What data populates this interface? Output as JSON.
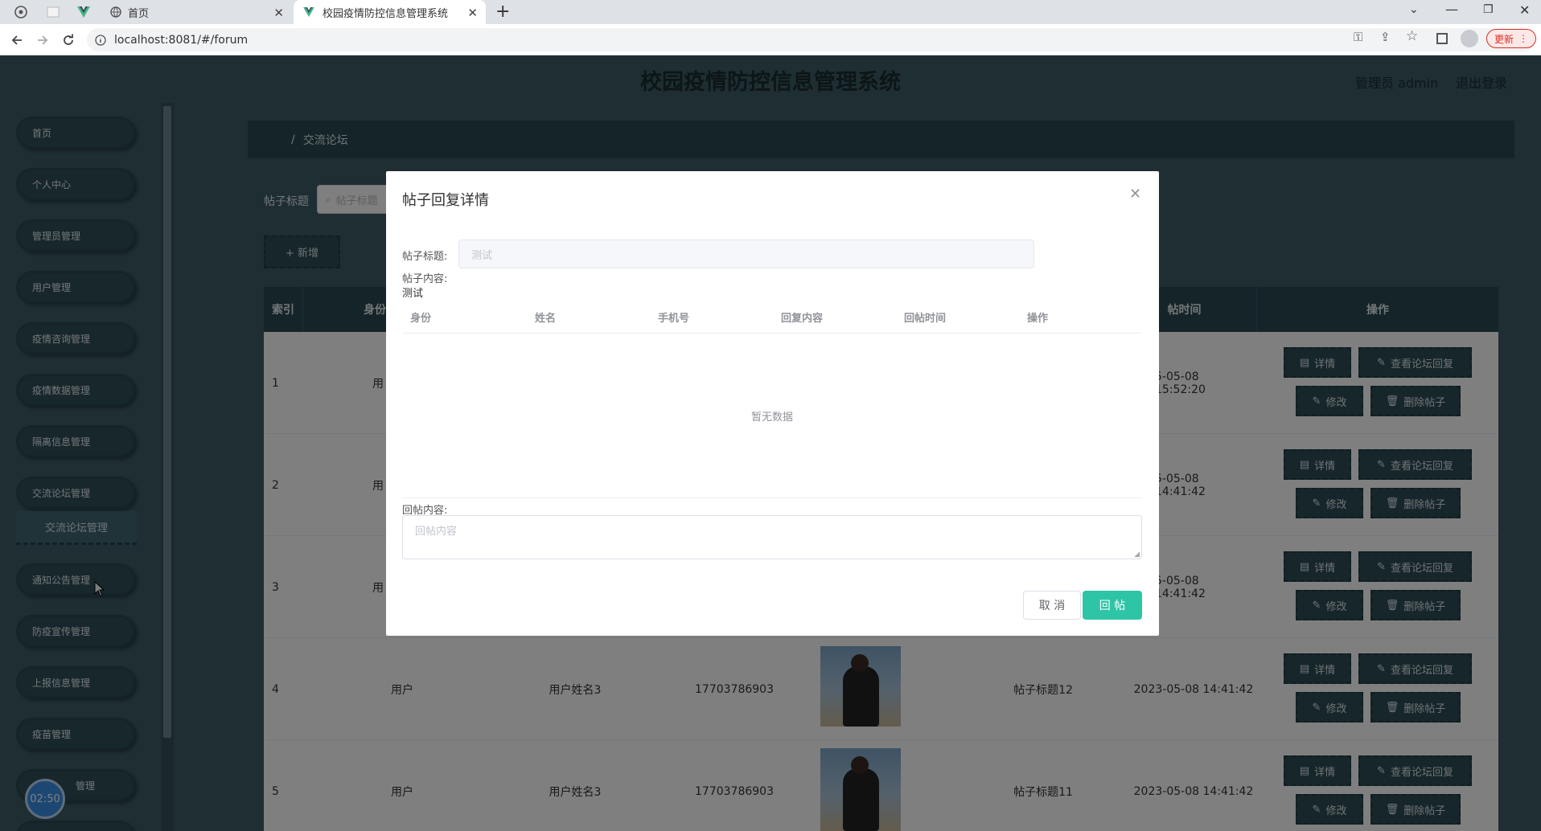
{
  "browser": {
    "tabs": [
      {
        "title": "首页"
      },
      {
        "title": "校园疫情防控信息管理系统"
      }
    ],
    "url": "localhost:8081/#/forum",
    "update_label": "更新"
  },
  "header": {
    "title": "校园疫情防控信息管理系统",
    "user": "管理员 admin",
    "logout": "退出登录"
  },
  "sidebar": {
    "items": [
      {
        "label": "首页"
      },
      {
        "label": "个人中心"
      },
      {
        "label": "管理员管理"
      },
      {
        "label": "用户管理"
      },
      {
        "label": "疫情咨询管理"
      },
      {
        "label": "疫情数据管理"
      },
      {
        "label": "隔离信息管理"
      },
      {
        "label": "交流论坛管理"
      },
      {
        "label": "通知公告管理"
      },
      {
        "label": "防疫宣传管理"
      },
      {
        "label": "上报信息管理"
      },
      {
        "label": "疫苗管理"
      },
      {
        "label": "管理"
      }
    ],
    "sub_item": "交流论坛管理",
    "timer": "02:50"
  },
  "breadcrumb": {
    "sep": "/",
    "current": "交流论坛"
  },
  "search": {
    "label": "帖子标题",
    "placeholder": "帖子标题"
  },
  "add_button": "+ 新增",
  "table": {
    "headers": {
      "index": "索引",
      "identity": "身份",
      "time": "帖时间",
      "actions": "操作"
    },
    "rows": [
      {
        "index": "1",
        "identity": "用",
        "name": "",
        "phone": "",
        "title": "",
        "time": "5-05-08 15:52:20"
      },
      {
        "index": "2",
        "identity": "用",
        "name": "",
        "phone": "",
        "title": "",
        "time": "5-05-08 14:41:42"
      },
      {
        "index": "3",
        "identity": "用",
        "name": "",
        "phone": "",
        "title": "",
        "time": "5-05-08 14:41:42"
      },
      {
        "index": "4",
        "identity": "用户",
        "name": "用户姓名3",
        "phone": "17703786903",
        "title": "帖子标题12",
        "time": "2023-05-08 14:41:42"
      },
      {
        "index": "5",
        "identity": "用户",
        "name": "用户姓名3",
        "phone": "17703786903",
        "title": "帖子标题11",
        "time": "2023-05-08 14:41:42"
      }
    ],
    "actions": {
      "detail": "详情",
      "view_reply": "查看论坛回复",
      "edit": "修改",
      "delete": "删除帖子"
    }
  },
  "dialog": {
    "title": "帖子回复详情",
    "post_title_label": "帖子标题:",
    "post_title_value": "测试",
    "post_content_label": "帖子内容:",
    "post_content_value": "测试",
    "columns": [
      "身份",
      "姓名",
      "手机号",
      "回复内容",
      "回帖时间",
      "操作"
    ],
    "empty_text": "暂无数据",
    "reply_label": "回帖内容:",
    "reply_placeholder": "回帖内容",
    "cancel": "取 消",
    "submit": "回 帖"
  },
  "colors": {
    "theme": "#3d5d66",
    "primary": "#2ec4a6"
  }
}
